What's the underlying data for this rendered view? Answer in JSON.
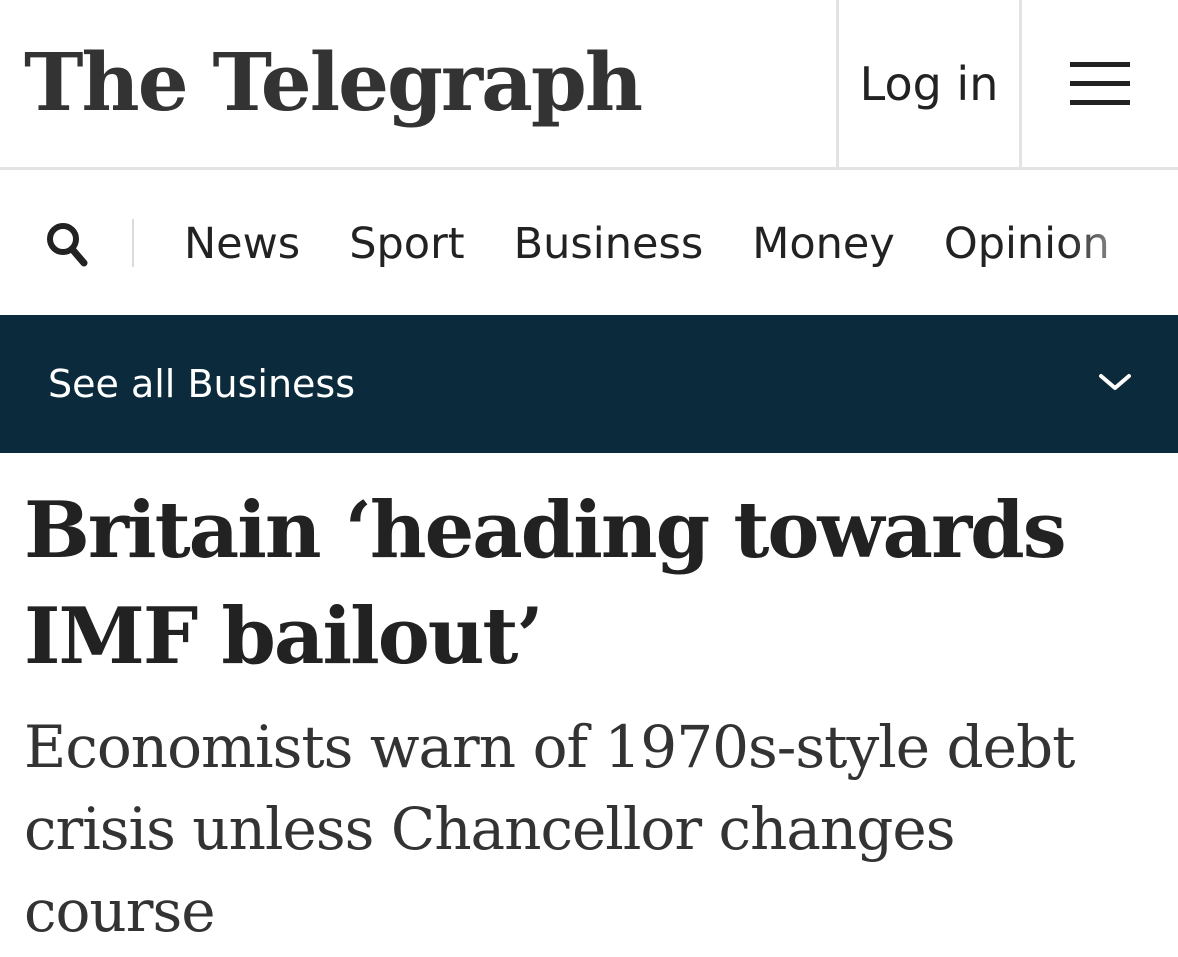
{
  "masthead": {
    "logo": "The Telegraph",
    "login_label": "Log in",
    "menu_icon": "hamburger-icon"
  },
  "nav": {
    "search_icon": "search-icon",
    "items": [
      {
        "label": "News"
      },
      {
        "label": "Sport"
      },
      {
        "label": "Business"
      },
      {
        "label": "Money"
      },
      {
        "label": "Opinion"
      }
    ]
  },
  "section_bar": {
    "label": "See all Business",
    "expand_icon": "chevron-down-icon",
    "background_color": "#0b2a3b"
  },
  "article": {
    "headline": "Britain ‘heading towards IMF bailout’",
    "standfirst": "Economists warn of 1970s-style debt crisis unless Chancellor changes course"
  }
}
